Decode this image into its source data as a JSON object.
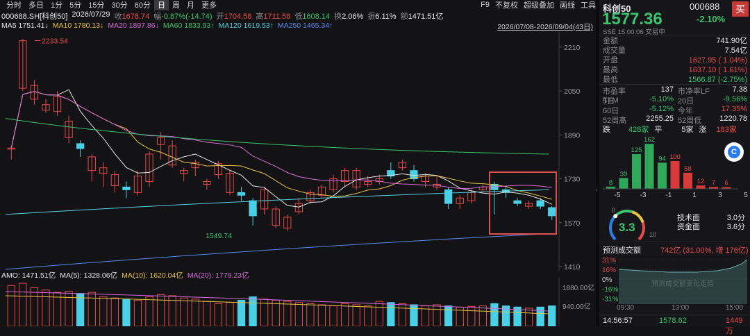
{
  "toolbar": {
    "items": [
      "分时",
      "多日",
      "1分",
      "5分",
      "15分",
      "30分",
      "60分",
      "日",
      "周",
      "月",
      "更多"
    ],
    "active": "日",
    "right": [
      "F9",
      "不复权",
      "超级叠加",
      "画线",
      "工具"
    ]
  },
  "info": {
    "code": "000688.SH[科创50]",
    "date": "2026/07/29",
    "close_label": "收",
    "close": "1678.74",
    "change_label": "幅",
    "change": "-0.87%(-14.74)",
    "open_label": "开",
    "open": "1704.58",
    "high_label": "高",
    "high": "1711.58",
    "low_label": "低",
    "low": "1608.14",
    "turnover_label": "换",
    "turnover": "2.06%",
    "amplitude_label": "振",
    "amplitude": "6.11%",
    "amount_label": "额",
    "amount": "1471.51亿"
  },
  "ma": {
    "ma5": "MA5",
    "ma5_val": "1751.41↓",
    "ma10": "MA10",
    "ma10_val": "1780.13↓",
    "ma20": "MA20",
    "ma20_val": "1897.86↓",
    "ma60": "MA60",
    "ma60_val": "1833.93↑",
    "ma120": "MA120",
    "ma120_val": "1619.53↑",
    "ma250": "MA250",
    "ma250_val": "1465.34↑"
  },
  "range": "2026/07/08-2026/09/04(43日)",
  "yaxis": [
    "2210",
    "2050",
    "1890",
    "1730",
    "1570",
    "1410"
  ],
  "annotations": {
    "max": "2233.54",
    "min": "1549.74"
  },
  "amo": {
    "amo": "AMO: 1471.51亿",
    "ma5": "MA(5): 1328.06亿",
    "ma10": "MA(10): 1620.04亿",
    "ma20": "MA(20): 1779.23亿"
  },
  "vol_axis": [
    "1880.00亿",
    "940.00亿"
  ],
  "chart_data": {
    "type": "candlestick",
    "y_range": [
      1410,
      2250
    ],
    "candles": [
      [
        1838,
        1842,
        1800,
        1850
      ],
      [
        2060,
        2233,
        2050,
        2240
      ],
      [
        2020,
        2070,
        2000,
        2090
      ],
      [
        1980,
        2000,
        1970,
        2020
      ],
      [
        1975,
        2030,
        1960,
        2050
      ],
      [
        1880,
        1940,
        1860,
        1960
      ],
      [
        1858,
        1840,
        1810,
        1870
      ],
      [
        1760,
        1810,
        1720,
        1820
      ],
      [
        1750,
        1770,
        1700,
        1790
      ],
      [
        1705,
        1745,
        1680,
        1760
      ],
      [
        1700,
        1690,
        1660,
        1720
      ],
      [
        1680,
        1740,
        1670,
        1760
      ],
      [
        1720,
        1820,
        1700,
        1830
      ],
      [
        1855,
        1880,
        1800,
        1900
      ],
      [
        1780,
        1850,
        1770,
        1870
      ],
      [
        1750,
        1760,
        1720,
        1770
      ],
      [
        1770,
        1790,
        1740,
        1800
      ],
      [
        1710,
        1720,
        1690,
        1730
      ],
      [
        1745,
        1785,
        1730,
        1795
      ],
      [
        1680,
        1750,
        1670,
        1760
      ],
      [
        1680,
        1670,
        1650,
        1700
      ],
      [
        1650,
        1595,
        1560,
        1660
      ],
      [
        1620,
        1690,
        1600,
        1700
      ],
      [
        1560,
        1620,
        1549,
        1630
      ],
      [
        1550,
        1590,
        1540,
        1600
      ],
      [
        1610,
        1640,
        1600,
        1660
      ],
      [
        1650,
        1680,
        1640,
        1690
      ],
      [
        1670,
        1700,
        1660,
        1710
      ],
      [
        1690,
        1730,
        1680,
        1745
      ],
      [
        1720,
        1760,
        1700,
        1770
      ],
      [
        1700,
        1760,
        1690,
        1770
      ],
      [
        1710,
        1720,
        1700,
        1740
      ],
      [
        1720,
        1730,
        1710,
        1745
      ],
      [
        1760,
        1740,
        1730,
        1790
      ],
      [
        1770,
        1790,
        1760,
        1800
      ],
      [
        1760,
        1730,
        1720,
        1780
      ],
      [
        1720,
        1740,
        1700,
        1750
      ],
      [
        1700,
        1710,
        1690,
        1740
      ],
      [
        1690,
        1640,
        1620,
        1700
      ],
      [
        1640,
        1660,
        1620,
        1670
      ],
      [
        1650,
        1680,
        1640,
        1690
      ],
      [
        1690,
        1700,
        1680,
        1710
      ],
      [
        1710,
        1690,
        1600,
        1720
      ],
      [
        1690,
        1680,
        1660,
        1700
      ],
      [
        1650,
        1640,
        1630,
        1660
      ],
      [
        1630,
        1640,
        1620,
        1650
      ],
      [
        1650,
        1630,
        1620,
        1660
      ],
      [
        1625,
        1595,
        1580,
        1630
      ]
    ],
    "volumes": [
      1800,
      1900,
      1700,
      1600,
      1500,
      1550,
      1450,
      1500,
      1300,
      1250,
      1200,
      1150,
      1300,
      1400,
      1350,
      1250,
      1200,
      1100,
      1000,
      1050,
      1150,
      1300,
      1200,
      1150,
      1100,
      1050,
      1000,
      950,
      900,
      1000,
      950,
      900,
      1100,
      1050,
      1000,
      950,
      900,
      950,
      900,
      850,
      880,
      900,
      1000,
      900,
      850,
      800,
      850,
      900
    ]
  },
  "quote": {
    "name": "科创50",
    "code": "000688",
    "price": "1577.36",
    "pct": "-2.10%",
    "status": "SSE 15:00:06 交易中",
    "buy": "买"
  },
  "stats": [
    {
      "l": "金额",
      "v": "741.90亿",
      "c": "white"
    },
    {
      "l": "成交量",
      "v": "7.54亿",
      "c": "white"
    },
    {
      "l": "开盘",
      "v": "1627.95 ( 1.04%)",
      "c": "red"
    },
    {
      "l": "最高",
      "v": "1637.10 ( 1.61%)",
      "c": "red"
    },
    {
      "l": "最低",
      "v": "1566.87 (-2.75%)",
      "c": "green"
    }
  ],
  "valuation": [
    {
      "l1": "市盈率TTM",
      "v1": "137",
      "c1": "white",
      "l2": "市净率LF",
      "v2": "7.38",
      "c2": "white"
    },
    {
      "l1": "5日",
      "v1": "-5.10%",
      "c1": "green",
      "l2": "20日",
      "v2": "-9.56%",
      "c2": "green"
    },
    {
      "l1": "60日",
      "v1": "-5.12%",
      "c1": "green",
      "l2": "今年",
      "v2": "17.35%",
      "c2": "red"
    },
    {
      "l1": "52周高",
      "v1": "2255.25",
      "c1": "white",
      "l2": "52周低",
      "v2": "1220.78",
      "c2": "white"
    }
  ],
  "breadth": {
    "down_label": "跌",
    "down": "428家",
    "flat_label": "平",
    "flat": "5家",
    "up_label": "涨",
    "up": "183家"
  },
  "dist": {
    "values": [
      8,
      39,
      125,
      162,
      94,
      100,
      58,
      12,
      7,
      6
    ],
    "labels": [
      "-5",
      "-3",
      "-1",
      "1",
      "3",
      "5"
    ]
  },
  "gauge": {
    "value": "3.3",
    "min": "0",
    "max": "10",
    "tech_label": "技术面",
    "tech": "3.0分",
    "fund_label": "资金面",
    "fund": "3.6分"
  },
  "forecast": {
    "label": "预测成交额",
    "value": "742亿 (31.00%, 增 176亿)",
    "watermark": "预测成交额变化走势",
    "yticks": [
      "31%",
      "16%",
      "0%",
      "-16%",
      "-31%"
    ],
    "xticks": [
      "09:30",
      "13:00",
      "15:00"
    ]
  },
  "footer": {
    "time": "14:56:57",
    "price": "1578.62",
    "volume": "1449万"
  }
}
